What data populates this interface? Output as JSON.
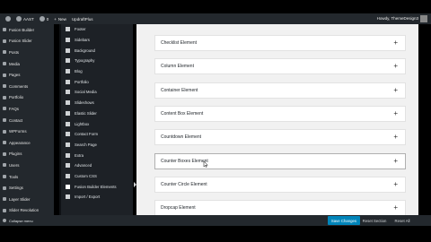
{
  "admin_bar": {
    "site_name": "AAST",
    "comments_count": "0",
    "new_label": "New",
    "updraft_label": "UpdraftPlus",
    "howdy": "Howdy, ThemeDesign3"
  },
  "admin_menu": {
    "items": [
      {
        "label": "Fusion Builder"
      },
      {
        "label": "Fusion Slider"
      },
      {
        "label": "Posts"
      },
      {
        "label": "Media"
      },
      {
        "label": "Pages"
      },
      {
        "label": "Comments"
      },
      {
        "label": "Portfolio"
      },
      {
        "label": "FAQs"
      },
      {
        "label": "Contact"
      },
      {
        "label": "WPForms"
      },
      {
        "label": "Appearance"
      },
      {
        "label": "Plugins"
      },
      {
        "label": "Users"
      },
      {
        "label": "Tools"
      },
      {
        "label": "Settings"
      },
      {
        "label": "Layer Slider"
      },
      {
        "label": "Slider Revolution"
      }
    ],
    "collapse_label": "Collapse menu"
  },
  "options_panel": {
    "items": [
      {
        "label": "Footer"
      },
      {
        "label": "Sidebars"
      },
      {
        "label": "Background"
      },
      {
        "label": "Typography"
      },
      {
        "label": "Blog"
      },
      {
        "label": "Portfolio"
      },
      {
        "label": "Social Media"
      },
      {
        "label": "Slideshows"
      },
      {
        "label": "Elastic Slider"
      },
      {
        "label": "Lightbox"
      },
      {
        "label": "Contact Form"
      },
      {
        "label": "Search Page"
      },
      {
        "label": "Extra"
      },
      {
        "label": "Advanced"
      },
      {
        "label": "Custom CSS"
      },
      {
        "label": "Fusion Builder Elements"
      },
      {
        "label": "Import / Export"
      }
    ],
    "active_index": 15
  },
  "elements": [
    {
      "label": "Checklist Element"
    },
    {
      "label": "Column Element"
    },
    {
      "label": "Container Element"
    },
    {
      "label": "Content Box Element"
    },
    {
      "label": "Countdown Element"
    },
    {
      "label": "Counter Boxes Element"
    },
    {
      "label": "Counter Circle Element"
    },
    {
      "label": "Dropcap Element"
    }
  ],
  "hovered_element_index": 5,
  "footer": {
    "save_label": "Save Changes",
    "reset_section_label": "Reset Section",
    "reset_all_label": "Reset All"
  },
  "colors": {
    "admin_bg": "#23282d",
    "content_bg": "#f1f1f1",
    "primary_button": "#0085ba"
  }
}
